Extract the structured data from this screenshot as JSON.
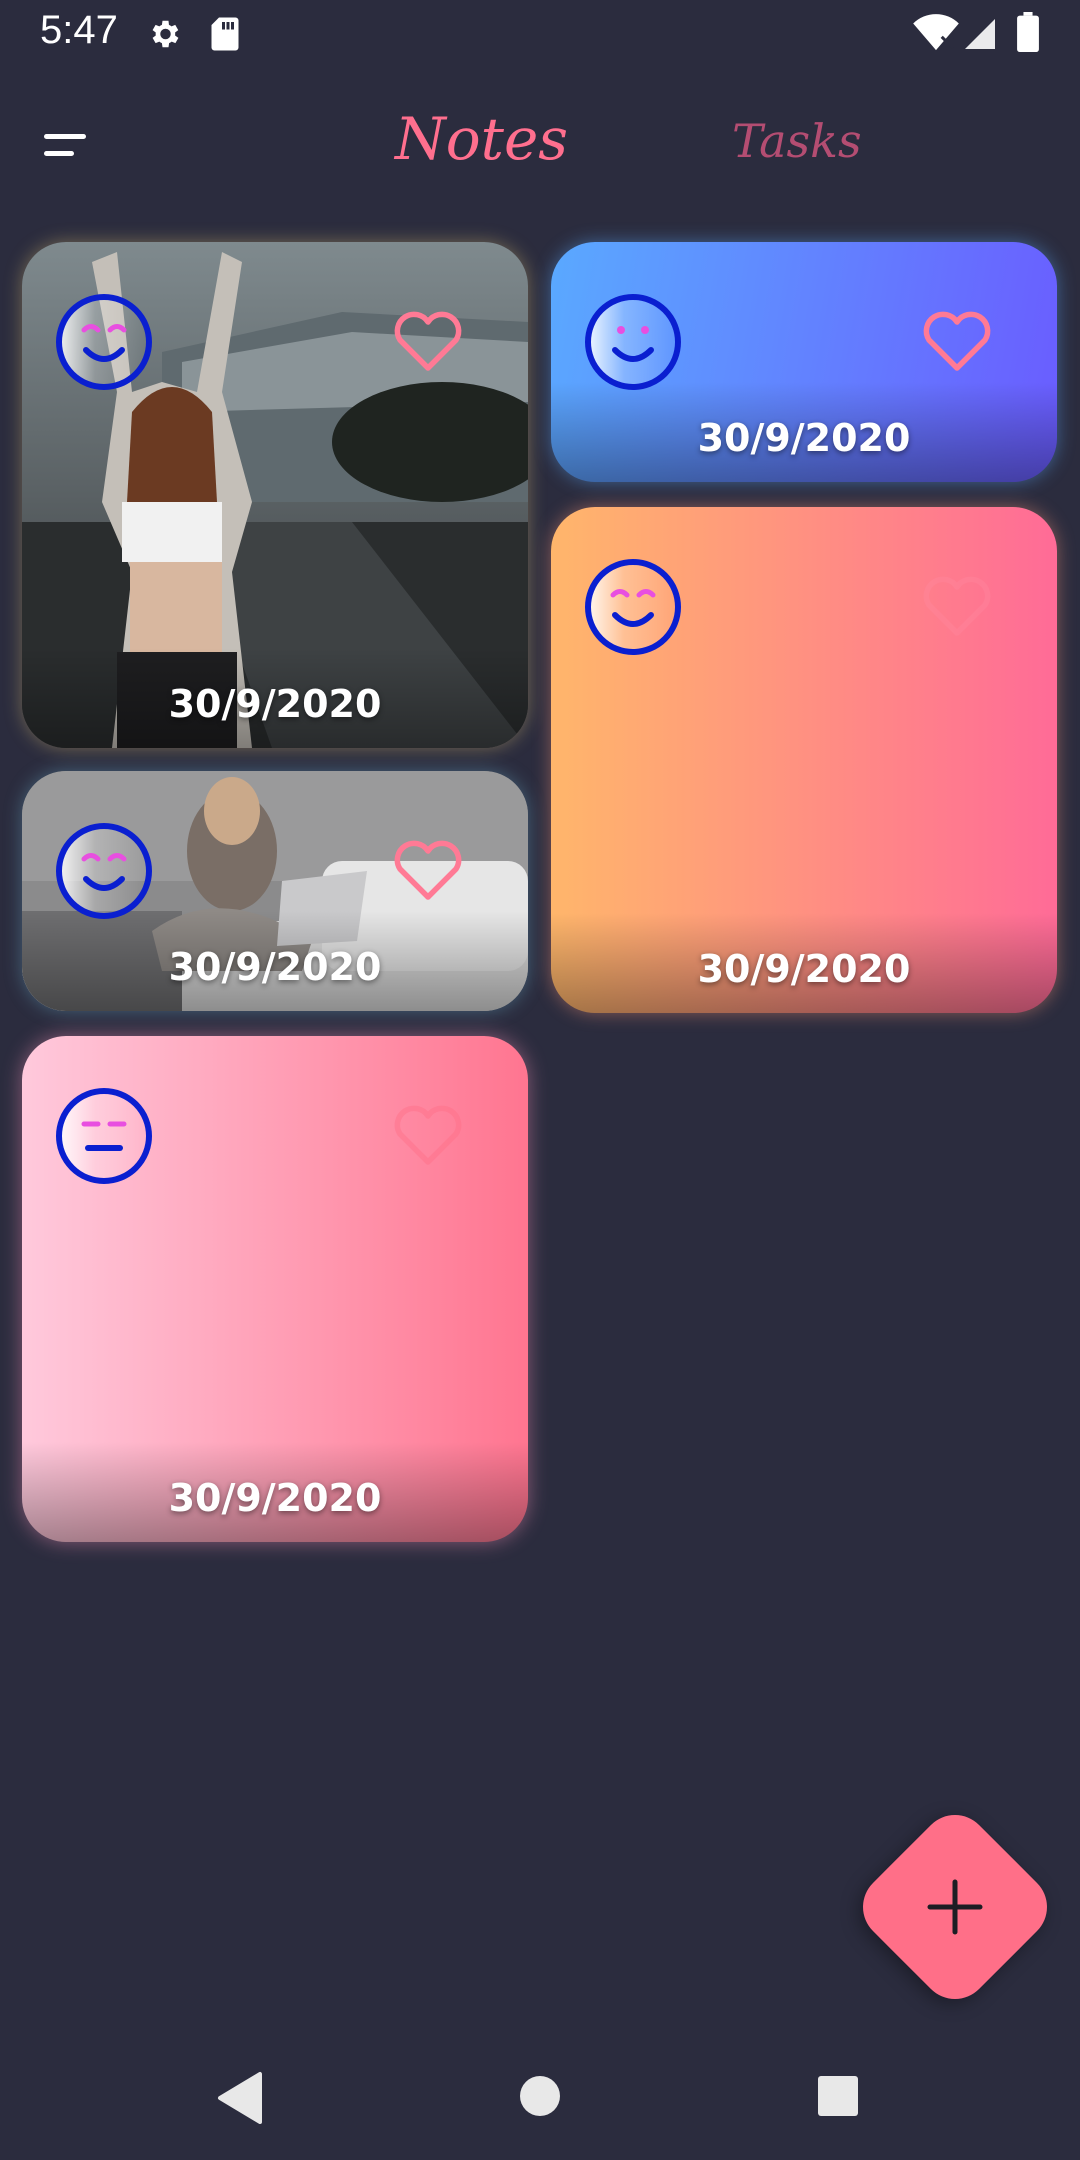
{
  "status_bar": {
    "time": "5:47",
    "icons": [
      "settings-icon",
      "sd-card-icon",
      "wifi-icon",
      "signal-icon",
      "battery-icon"
    ]
  },
  "app_bar": {
    "menu_icon": "menu-icon",
    "tabs": [
      {
        "label": "Notes",
        "active": true
      },
      {
        "label": "Tasks",
        "active": false
      }
    ]
  },
  "notes": [
    {
      "date": "30/9/2020",
      "mood": "smiling-face-icon",
      "favorite": true,
      "background": "photo-woman-stretching"
    },
    {
      "date": "30/9/2020",
      "mood": "smiling-face-icon",
      "favorite": true,
      "background": "gradient-blue-purple"
    },
    {
      "date": "30/9/2020",
      "mood": "smiling-face-icon",
      "favorite": false,
      "background": "gradient-orange-pink"
    },
    {
      "date": "30/9/2020",
      "mood": "smiling-face-icon",
      "favorite": true,
      "background": "photo-woman-laptop-bed"
    },
    {
      "date": "30/9/2020",
      "mood": "neutral-face-icon",
      "favorite": false,
      "background": "gradient-pink"
    }
  ],
  "fab": {
    "icon": "plus-icon"
  },
  "navigation_bar": {
    "icons": [
      "back-icon",
      "home-icon",
      "recents-icon"
    ]
  },
  "colors": {
    "background": "#2b2c3e",
    "accent": "#ff6f8e",
    "tab_inactive": "#b44d72",
    "emoji_stroke": "#0a1fd0",
    "emoji_eyes": "#e84fe0",
    "heart": "#ff7a95"
  }
}
